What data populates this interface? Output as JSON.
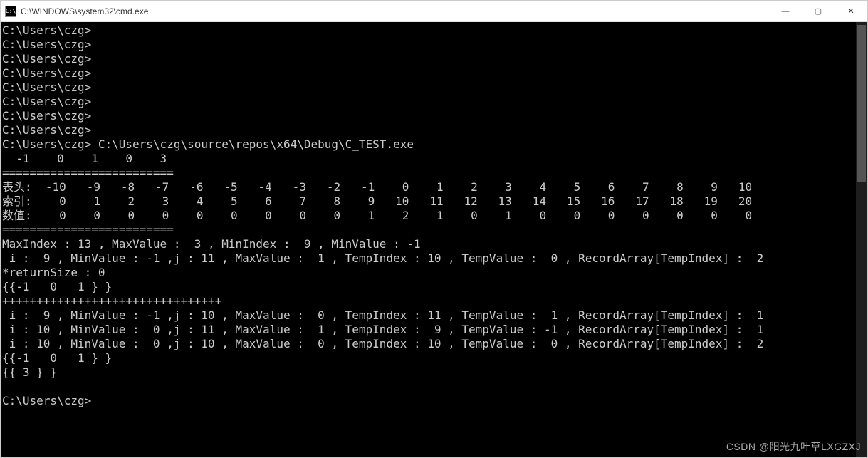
{
  "window": {
    "icon_label": "C:\\",
    "title": "C:\\WINDOWS\\system32\\cmd.exe",
    "controls": {
      "min": "—",
      "max": "▢",
      "close": "✕"
    }
  },
  "terminal": {
    "lines": [
      "C:\\Users\\czg>",
      "C:\\Users\\czg>",
      "C:\\Users\\czg>",
      "C:\\Users\\czg>",
      "C:\\Users\\czg>",
      "C:\\Users\\czg>",
      "C:\\Users\\czg>",
      "C:\\Users\\czg>",
      "C:\\Users\\czg> C:\\Users\\czg\\source\\repos\\x64\\Debug\\C_TEST.exe",
      "  -1    0    1    0    3",
      "=========================",
      "表头:  -10   -9   -8   -7   -6   -5   -4   -3   -2   -1    0    1    2    3    4    5    6    7    8    9   10",
      "索引:    0    1    2    3    4    5    6    7    8    9   10   11   12   13   14   15   16   17   18   19   20",
      "数值:    0    0    0    0    0    0    0    0    0    1    2    1    0    1    0    0    0    0    0    0    0",
      "=========================",
      "MaxIndex : 13 , MaxValue :  3 , MinIndex :  9 , MinValue : -1",
      " i :  9 , MinValue : -1 ,j : 11 , MaxValue :  1 , TempIndex : 10 , TempValue :  0 , RecordArray[TempIndex] :  2",
      "*returnSize : 0",
      "{{-1   0   1 } }",
      "++++++++++++++++++++++++++++++++",
      " i :  9 , MinValue : -1 ,j : 10 , MaxValue :  0 , TempIndex : 11 , TempValue :  1 , RecordArray[TempIndex] :  1",
      " i : 10 , MinValue :  0 ,j : 11 , MaxValue :  1 , TempIndex :  9 , TempValue : -1 , RecordArray[TempIndex] :  1",
      " i : 10 , MinValue :  0 ,j : 10 , MaxValue :  0 , TempIndex : 10 , TempValue :  0 , RecordArray[TempIndex] :  2",
      "{{-1   0   1 } }",
      "{{ 3 } }",
      "",
      "C:\\Users\\czg>"
    ]
  },
  "watermark": "CSDN @阳光九叶草LXGZXJ"
}
